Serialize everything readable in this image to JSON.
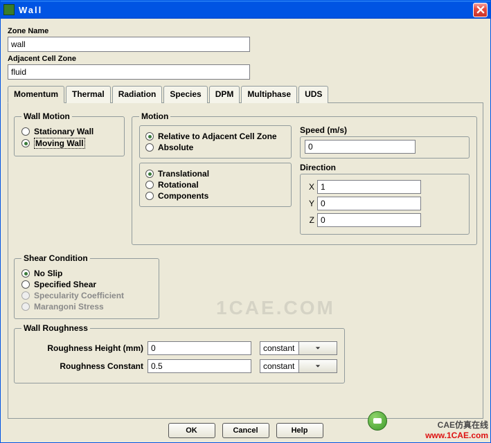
{
  "window": {
    "title": "Wall"
  },
  "fields": {
    "zone_name_label": "Zone Name",
    "zone_name_value": "wall",
    "adj_zone_label": "Adjacent Cell Zone",
    "adj_zone_value": "fluid"
  },
  "tabs": {
    "momentum": "Momentum",
    "thermal": "Thermal",
    "radiation": "Radiation",
    "species": "Species",
    "dpm": "DPM",
    "multiphase": "Multiphase",
    "uds": "UDS"
  },
  "wall_motion": {
    "legend": "Wall Motion",
    "stationary": "Stationary Wall",
    "moving": "Moving Wall"
  },
  "motion": {
    "legend": "Motion",
    "relative": "Relative to Adjacent Cell Zone",
    "absolute": "Absolute",
    "translational": "Translational",
    "rotational": "Rotational",
    "components": "Components",
    "speed_label": "Speed (m/s)",
    "speed_value": "0",
    "direction_label": "Direction",
    "x_label": "X",
    "x_value": "1",
    "y_label": "Y",
    "y_value": "0",
    "z_label": "Z",
    "z_value": "0"
  },
  "shear": {
    "legend": "Shear Condition",
    "no_slip": "No Slip",
    "specified": "Specified Shear",
    "specularity": "Specularity Coefficient",
    "marangoni": "Marangoni Stress"
  },
  "roughness": {
    "legend": "Wall Roughness",
    "height_label": "Roughness Height (mm)",
    "height_value": "0",
    "height_combo": "constant",
    "constant_label": "Roughness Constant",
    "constant_value": "0.5",
    "constant_combo": "constant"
  },
  "buttons": {
    "ok": "OK",
    "cancel": "Cancel",
    "help": "Help"
  },
  "watermark": {
    "center": "1CAE.COM",
    "line1": "CAE仿真在线",
    "line2": "www.1CAE.com"
  }
}
